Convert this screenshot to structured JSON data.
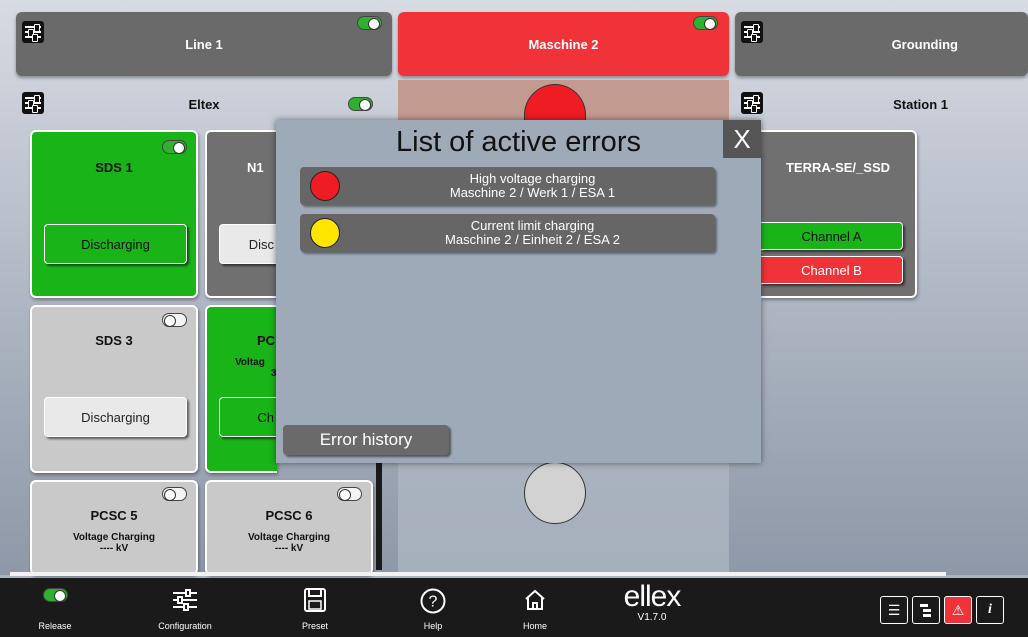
{
  "columns": {
    "left": {
      "title": "Line 1",
      "sub_title": "Eltex"
    },
    "middle": {
      "title": "Maschine 2"
    },
    "right": {
      "title": "Grounding",
      "sub_title": "Station 1"
    }
  },
  "cards": {
    "sds1": {
      "title": "SDS 1",
      "button": "Discharging"
    },
    "n1": {
      "title": "N1",
      "button": "Disc"
    },
    "sds3": {
      "title": "SDS 3",
      "button": "Discharging"
    },
    "pc": {
      "title": "PC",
      "sub1": "Voltag",
      "sub2": "3",
      "button": "Ch"
    },
    "pcsc5": {
      "title": "PCSC 5",
      "sub1": "Voltage Charging",
      "sub2": "---- kV"
    },
    "pcsc6": {
      "title": "PCSC 6",
      "sub1": "Voltage Charging",
      "sub2": "---- kV"
    },
    "terra": {
      "title": "TERRA-SE/_SSD",
      "channel_a": "Channel A",
      "channel_b": "Channel B"
    }
  },
  "modal": {
    "title": "List of active errors",
    "close_label": "X",
    "errors": [
      {
        "line1": "High voltage charging",
        "line2": "Maschine 2 / Werk 1 / ESA 1",
        "color": "#ef1c24"
      },
      {
        "line1": "Current limit charging",
        "line2": "Maschine 2 / Einheit 2 / ESA 2",
        "color": "#ffe400"
      }
    ],
    "history_button": "Error history"
  },
  "footer": {
    "items": [
      {
        "label": "Release",
        "icon": "toggle-icon"
      },
      {
        "label": "Configuration",
        "icon": "sliders-icon"
      },
      {
        "label": "Preset",
        "icon": "save-icon"
      },
      {
        "label": "Help",
        "icon": "help-icon"
      },
      {
        "label": "Home",
        "icon": "home-icon"
      }
    ],
    "logo": "ellex",
    "version": "V1.7.0",
    "right_icons": [
      "list-icon",
      "tree-icon",
      "warning-icon",
      "info-icon"
    ],
    "warning_glyph": "⚠",
    "info_glyph": "i",
    "list_glyph": "☰"
  },
  "colors": {
    "accent_red": "#ef3338",
    "accent_green": "#18b418"
  }
}
